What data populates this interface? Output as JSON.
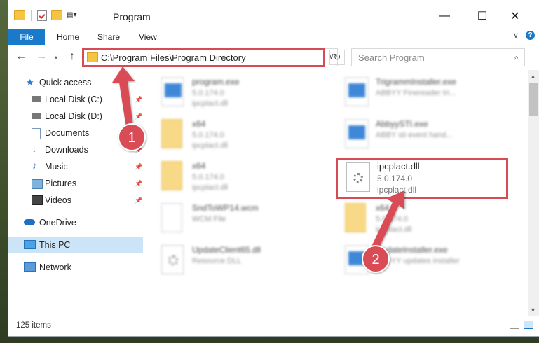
{
  "window": {
    "title": "Program",
    "minimize": "—",
    "maximize": "☐",
    "close": "✕"
  },
  "ribbon": {
    "file": "File",
    "tabs": [
      "Home",
      "Share",
      "View"
    ],
    "expand": "∨",
    "help": "?"
  },
  "address": {
    "path": "C:\\Program Files\\Program Directory",
    "dropdown": "∨",
    "refresh": "↻"
  },
  "search": {
    "placeholder": "Search Program",
    "icon": "⌕"
  },
  "nav": {
    "back": "←",
    "forward": "→",
    "recent": "∨",
    "up": "↑"
  },
  "sidebar": {
    "items": [
      {
        "label": "Quick access",
        "icon": "star-icon",
        "pinned": false
      },
      {
        "label": "Local Disk (C:)",
        "icon": "drive-icon",
        "pinned": true
      },
      {
        "label": "Local Disk (D:)",
        "icon": "drive-icon",
        "pinned": true
      },
      {
        "label": "Documents",
        "icon": "documents-icon",
        "pinned": true
      },
      {
        "label": "Downloads",
        "icon": "downloads-icon",
        "pinned": true
      },
      {
        "label": "Music",
        "icon": "music-icon",
        "pinned": true
      },
      {
        "label": "Pictures",
        "icon": "pictures-icon",
        "pinned": true
      },
      {
        "label": "Videos",
        "icon": "videos-icon",
        "pinned": true
      },
      {
        "label": "OneDrive",
        "icon": "onedrive-icon"
      },
      {
        "label": "This PC",
        "icon": "pc-icon",
        "selected": true
      },
      {
        "label": "Network",
        "icon": "network-icon"
      }
    ]
  },
  "files": {
    "left": [
      {
        "name": "program.exe",
        "line1": "5.0.174.0",
        "line2": "ipcplact.dll",
        "icon": "exe-icon"
      },
      {
        "name": "x64",
        "line1": "5.0.174.0",
        "line2": "ipcplact.dll",
        "icon": "folder-icon"
      },
      {
        "name": "x64",
        "line1": "5.0.174.0",
        "line2": "ipcplact.dll",
        "icon": "folder-icon"
      },
      {
        "name": "SndToWP14.wcm",
        "line1": "WCM File",
        "line2": "",
        "icon": "file-icon"
      },
      {
        "name": "UpdateClient65.dll",
        "line1": "Resource DLL",
        "line2": "",
        "icon": "dll-icon"
      }
    ],
    "right": [
      {
        "name": "TrigrammInstaller.exe",
        "line1": "ABBYY Finereader tri...",
        "icon": "app-icon"
      },
      {
        "name": "AbbyySTI.exe",
        "line1": "ABBY sti event hand...",
        "icon": "app-icon"
      },
      {
        "name": "x64",
        "line1": "5.0.174.0",
        "line2": "ipcplact.dll",
        "icon": "folder-icon"
      },
      {
        "name": "UpdateInstaller.exe",
        "line1": "ABBYY updates installer",
        "icon": "app-icon"
      }
    ],
    "highlighted": {
      "name": "ipcplact.dll",
      "line1": "5.0.174.0",
      "line2": "ipcplact.dll",
      "icon": "dll-gear-icon"
    }
  },
  "status": {
    "items": "125 items"
  },
  "annotations": {
    "badge1": "1",
    "badge2": "2",
    "color": "#d94b54"
  }
}
